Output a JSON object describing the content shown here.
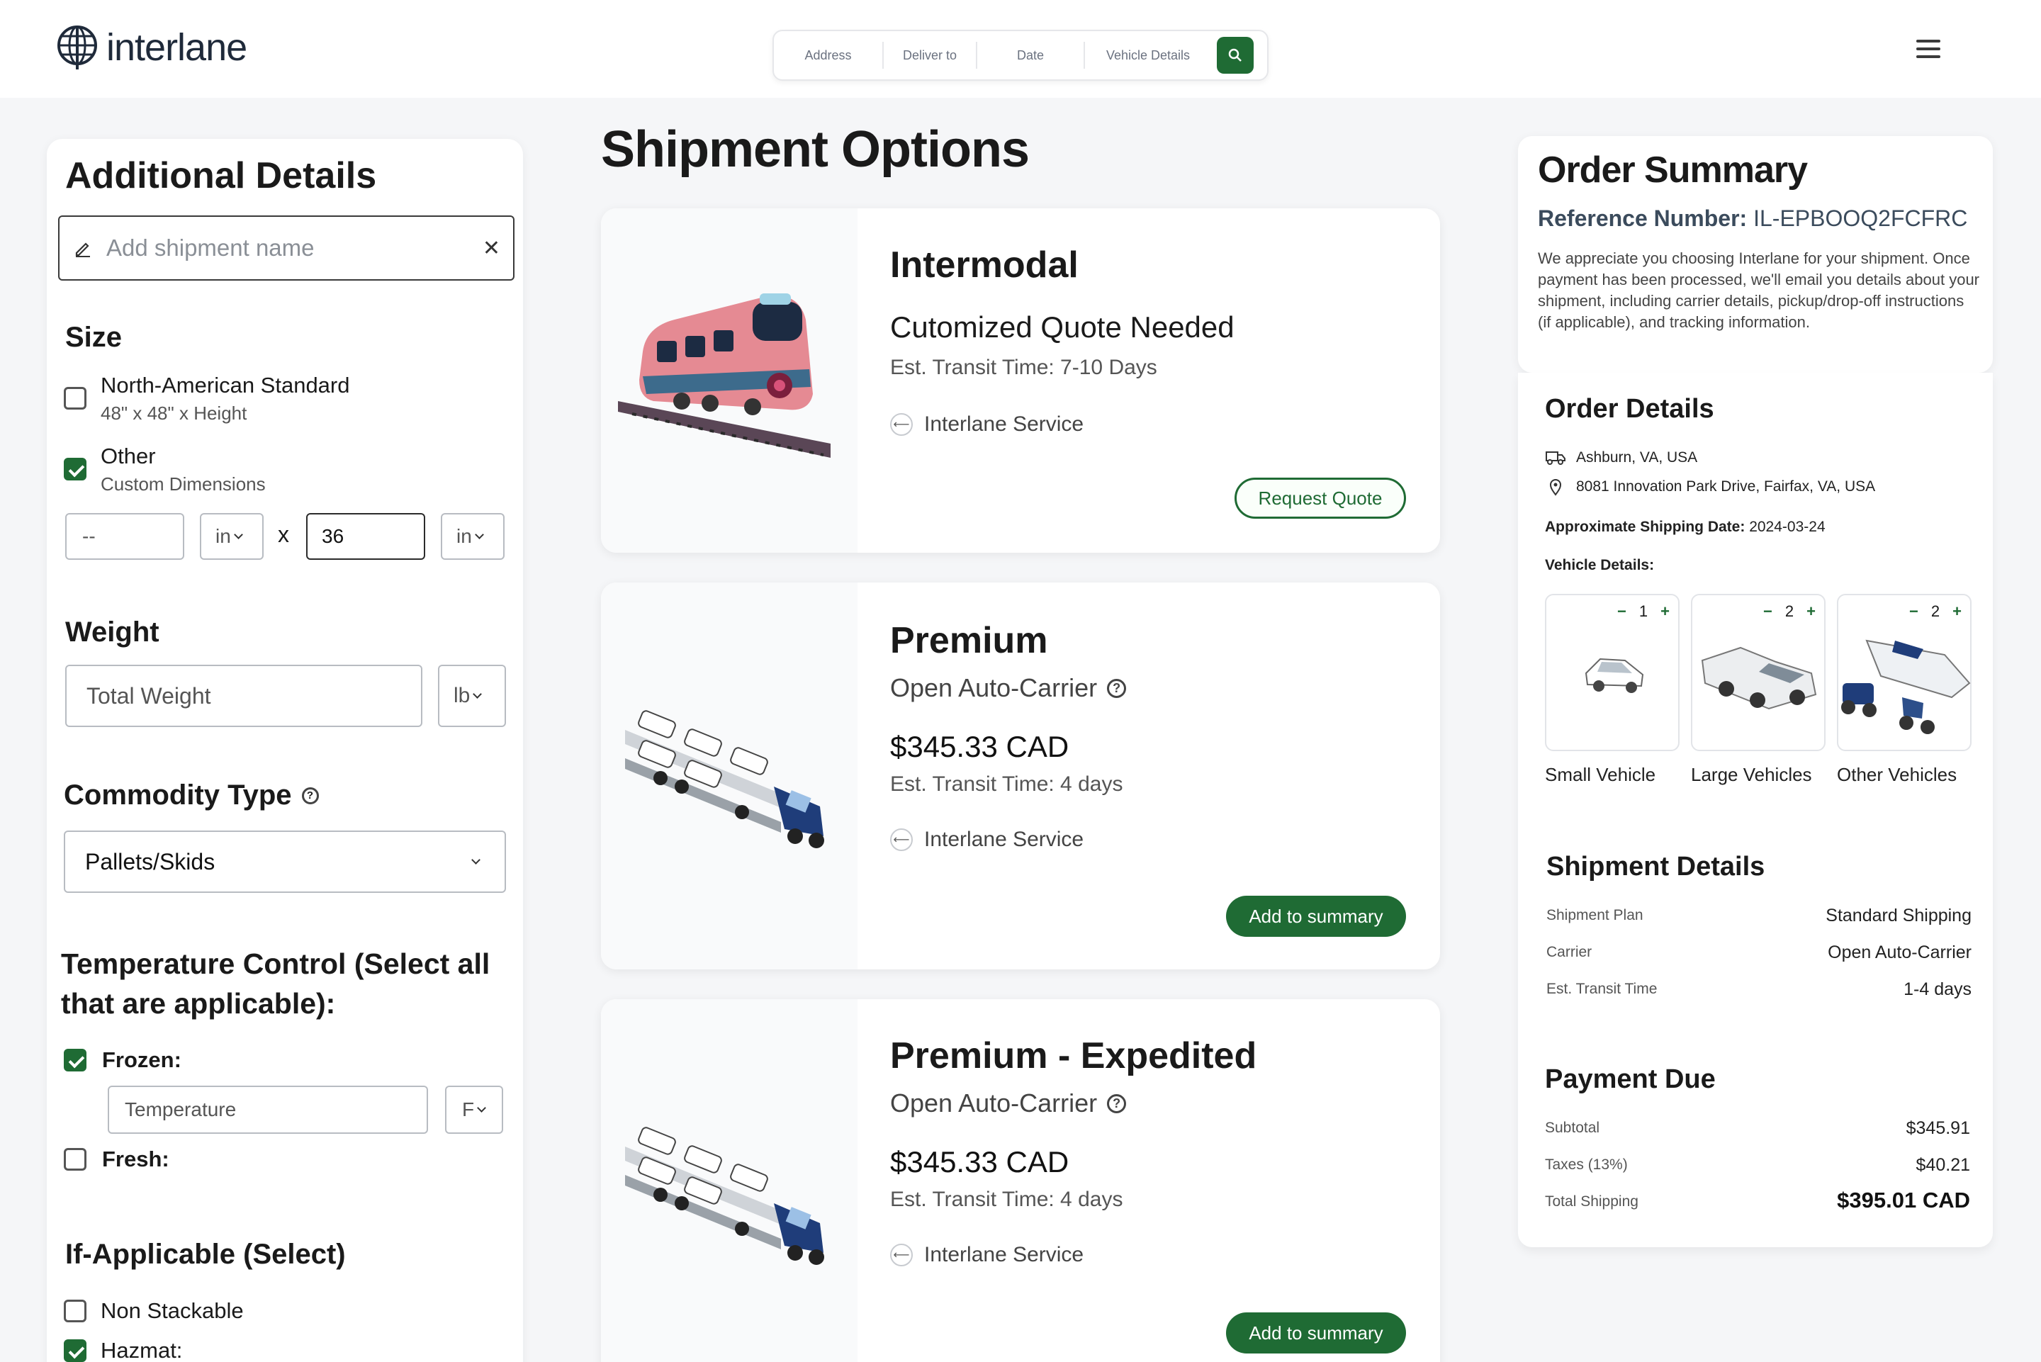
{
  "header": {
    "brand": "interlane",
    "search": {
      "address": "Address",
      "deliver_to": "Deliver to",
      "date": "Date",
      "vehicle_details": "Vehicle Details"
    }
  },
  "additional_details": {
    "title": "Additional Details",
    "name_placeholder": "Add shipment name",
    "size": {
      "heading": "Size",
      "options": [
        {
          "label": "North-American Standard",
          "sub": "48\" x 48\" x Height",
          "checked": false
        },
        {
          "label": "Other",
          "sub": "Custom Dimensions",
          "checked": true
        }
      ],
      "dim1_value": "--",
      "dim1_unit": "in",
      "times": "x",
      "dim2_value": "36",
      "dim2_unit": "in"
    },
    "weight": {
      "heading": "Weight",
      "placeholder": "Total Weight",
      "unit": "lb"
    },
    "commodity": {
      "heading": "Commodity Type",
      "value": "Pallets/Skids"
    },
    "temperature": {
      "heading_line1": "Temperature Control (Select all",
      "heading_line2": "that are applicable):",
      "frozen_label": "Frozen:",
      "frozen_checked": true,
      "temp_placeholder": "Temperature",
      "temp_unit": "F",
      "fresh_label": "Fresh:",
      "fresh_checked": false
    },
    "if_applicable": {
      "heading": "If-Applicable (Select)",
      "non_stackable": "Non Stackable",
      "hazmat": "Hazmat:"
    }
  },
  "shipment_options": {
    "title": "Shipment Options",
    "cards": [
      {
        "title": "Intermodal",
        "subtitle": "Cutomized Quote Needed",
        "transit": "Est. Transit Time: 7-10 Days",
        "service": "Interlane Service",
        "button": "Request Quote"
      },
      {
        "title": "Premium",
        "subtitle": "Open Auto-Carrier",
        "price": "$345.33 CAD",
        "transit": "Est. Transit Time: 4 days",
        "service": "Interlane Service",
        "button": "Add to summary"
      },
      {
        "title": "Premium - Expedited",
        "subtitle": "Open Auto-Carrier",
        "price": "$345.33 CAD",
        "transit": "Est. Transit Time: 4 days",
        "service": "Interlane Service",
        "button": "Add to summary"
      }
    ]
  },
  "order_summary": {
    "title": "Order Summary",
    "ref_label": "Reference Number:",
    "ref_value": "IL-EPBOOQ2FCFRC",
    "message": "We appreciate you choosing Interlane for your shipment. Once payment has been processed, we'll email you details about your shipment, including carrier details, pickup/drop-off instructions (if applicable), and tracking information.",
    "order_details": {
      "heading": "Order Details",
      "from": "Ashburn, VA, USA",
      "to": "8081 Innovation Park Drive, Fairfax, VA, USA",
      "date_label": "Approximate Shipping Date:",
      "date_value": "2024-03-24",
      "vehicle_label": "Vehicle Details:",
      "vehicles": [
        {
          "label": "Small Vehicle",
          "count": "1"
        },
        {
          "label": "Large Vehicles",
          "count": "2"
        },
        {
          "label": "Other Vehicles",
          "count": "2"
        }
      ]
    },
    "shipment_details": {
      "heading": "Shipment Details",
      "rows": [
        {
          "k": "Shipment Plan",
          "v": "Standard Shipping"
        },
        {
          "k": "Carrier",
          "v": "Open Auto-Carrier"
        },
        {
          "k": "Est. Transit Time",
          "v": "1-4 days"
        }
      ]
    },
    "payment": {
      "heading": "Payment Due",
      "rows": [
        {
          "k": "Subtotal",
          "v": "$345.91"
        },
        {
          "k": "Taxes (13%)",
          "v": "$40.21"
        },
        {
          "k": "Total Shipping",
          "v": "$395.01 CAD"
        }
      ]
    }
  },
  "colors": {
    "accent": "#1f6b34",
    "page_bg": "#f5f6f8"
  }
}
